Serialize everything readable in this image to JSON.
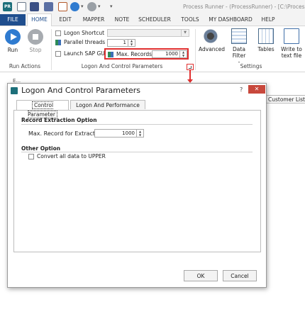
{
  "titlebar": {
    "app_icon_text": "PR",
    "title": "Process Runner - (ProcessRunner) - [C:\\Process"
  },
  "ribbon_tabs": [
    {
      "label": "FILE"
    },
    {
      "label": "HOME"
    },
    {
      "label": "EDIT"
    },
    {
      "label": "MAPPER"
    },
    {
      "label": "NOTE"
    },
    {
      "label": "SCHEDULER"
    },
    {
      "label": "TOOLS"
    },
    {
      "label": "MY DASHBOARD"
    },
    {
      "label": "HELP"
    }
  ],
  "ribbon": {
    "run_label": "Run",
    "stop_label": "Stop",
    "run_actions_group": "Run Actions",
    "logon_shortcut_label": "Logon Shortcut",
    "parallel_threads_label": "Parallel threads",
    "parallel_threads_value": "1",
    "launch_sap_gui_label": "Launch SAP GUI",
    "max_records_label": "Max. Records",
    "max_records_value": "1000",
    "logon_group": "Logon And Control Parameters",
    "advanced_label": "Advanced",
    "data_filter_label": "Data Filter",
    "data_filter_sub": "-",
    "tables_label": "Tables",
    "write_to_text_label": "Write to",
    "write_to_text_label2": "text file",
    "settings_group": "Settings"
  },
  "workspace": {
    "tab_label": "Customer List fro",
    "fragment_text": "E..."
  },
  "dialog": {
    "title": "Logon And Control Parameters",
    "help": "?",
    "close": "✕",
    "tabs": [
      {
        "label": "Control Parameter"
      },
      {
        "label": "Logon And Performance"
      }
    ],
    "record_section": "Record Extraction Option",
    "max_record_label": "Max. Record for Extraction",
    "max_record_value": "1000",
    "other_section": "Other Option",
    "convert_upper_label": "Convert all data to UPPER",
    "ok_label": "OK",
    "cancel_label": "Cancel"
  },
  "colors": {
    "accent": "#1f4e8e",
    "highlight": "#e03030",
    "close_button": "#c8483c"
  }
}
